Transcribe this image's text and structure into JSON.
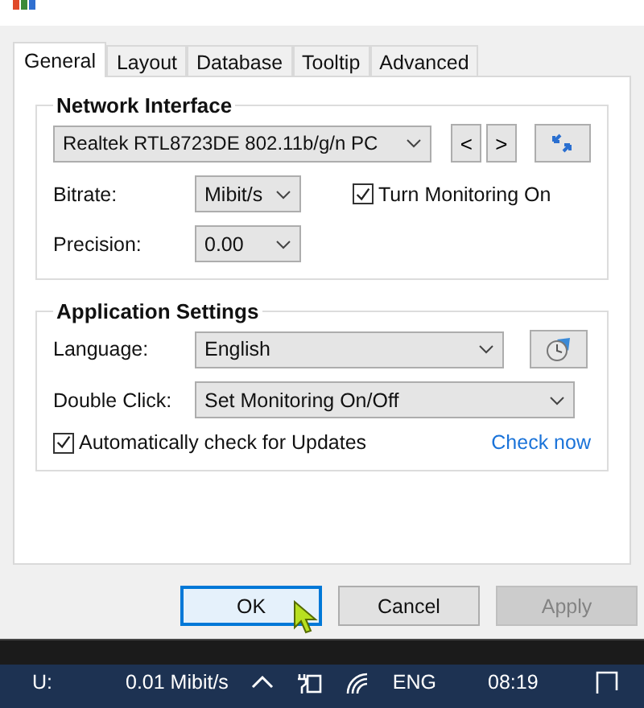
{
  "tabs": [
    {
      "label": "General",
      "selected": true
    },
    {
      "label": "Layout",
      "selected": false
    },
    {
      "label": "Database",
      "selected": false
    },
    {
      "label": "Tooltip",
      "selected": false
    },
    {
      "label": "Advanced",
      "selected": false
    }
  ],
  "network_interface": {
    "title": "Network Interface",
    "adapter": "Realtek RTL8723DE 802.11b/g/n PC",
    "prev": "<",
    "next": ">",
    "bitrate_label": "Bitrate:",
    "bitrate": "Mibit/s",
    "precision_label": "Precision:",
    "precision": "0.00",
    "monitoring": {
      "label": "Turn Monitoring On",
      "checked": true
    }
  },
  "application_settings": {
    "title": "Application Settings",
    "language_label": "Language:",
    "language": "English",
    "double_click_label": "Double Click:",
    "double_click": "Set Monitoring On/Off",
    "auto_update": {
      "label": "Automatically check for Updates",
      "checked": true
    },
    "check_now": "Check now"
  },
  "buttons": [
    {
      "label": "OK",
      "default": true,
      "disabled": false
    },
    {
      "label": "Cancel",
      "default": false,
      "disabled": false
    },
    {
      "label": "Apply",
      "default": false,
      "disabled": true
    }
  ],
  "taskbar": {
    "upload_label": "U:",
    "upload_rate": "0.01 Mibit/s",
    "language": "ENG",
    "time": "08:19"
  }
}
